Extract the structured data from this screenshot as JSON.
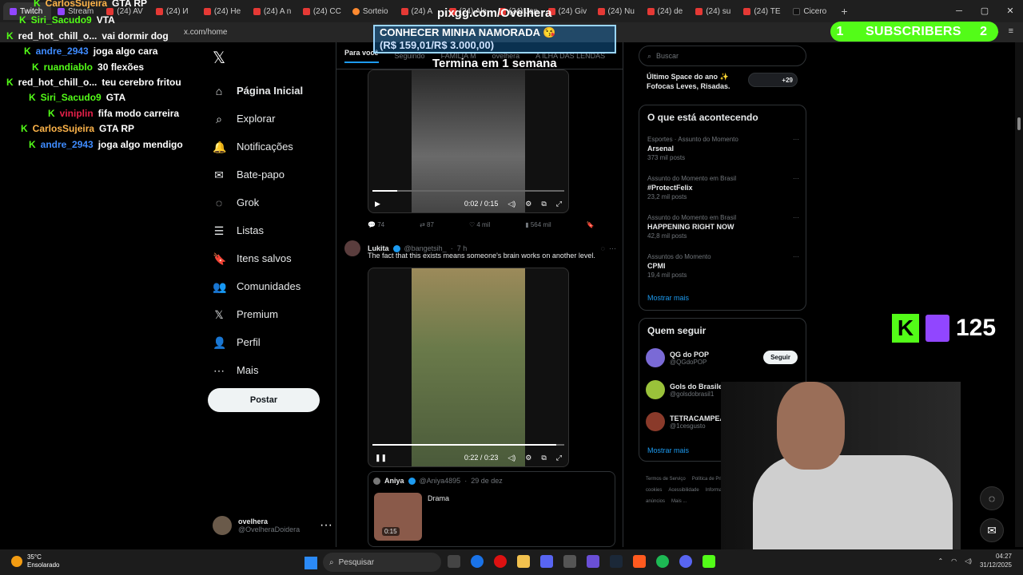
{
  "browser": {
    "tabs": [
      {
        "label": "Twitch",
        "icon": "twitch-icon"
      },
      {
        "label": "Stream",
        "icon": "twitch-icon"
      },
      {
        "label": "(24) AV",
        "icon": "youtube-icon"
      },
      {
        "label": "(24) И",
        "icon": "youtube-icon"
      },
      {
        "label": "(24) He",
        "icon": "youtube-icon"
      },
      {
        "label": "(24) A n",
        "icon": "youtube-icon"
      },
      {
        "label": "(24) CC",
        "icon": "youtube-icon"
      },
      {
        "label": "Sorteio",
        "icon": "sorteio-icon"
      },
      {
        "label": "(24) A",
        "icon": "youtube-icon"
      },
      {
        "label": "(24) Ale",
        "icon": "youtube-icon"
      },
      {
        "label": "(24) Jan",
        "icon": "youtube-icon"
      },
      {
        "label": "(24) Giv",
        "icon": "youtube-icon"
      },
      {
        "label": "(24) Nu",
        "icon": "youtube-icon"
      },
      {
        "label": "(24) de",
        "icon": "youtube-icon"
      },
      {
        "label": "(24) su",
        "icon": "youtube-icon"
      },
      {
        "label": "(24) TE",
        "icon": "youtube-icon"
      },
      {
        "label": "Cicero",
        "icon": "tiktok-icon"
      }
    ],
    "new_tab": "+",
    "address": "x.com/home"
  },
  "overlay": {
    "chat": [
      {
        "user": "CarlosSujeira",
        "msg": "GTA RP",
        "color": "#ffb54a"
      },
      {
        "user": "Siri_Sacudo9",
        "msg": "VTA",
        "color": "#53fc18"
      },
      {
        "user": "red_hot_chill_o...",
        "msg": "vai dormir dog",
        "color": "#ffffff"
      },
      {
        "user": "andre_2943",
        "msg": "joga algo cara",
        "color": "#3f8cff"
      },
      {
        "user": "ruandiablo",
        "msg": "30 flexões",
        "color": "#53fc18"
      },
      {
        "user": "red_hot_chill_o...",
        "msg": "teu cerebro fritou",
        "color": "#ffffff"
      },
      {
        "user": "Siri_Sacudo9",
        "msg": "GTA",
        "color": "#53fc18"
      },
      {
        "user": "viniplin",
        "msg": "fifa modo carreira",
        "color": "#e6204a"
      },
      {
        "user": "CarlosSujeira",
        "msg": "GTA RP",
        "color": "#ffb54a"
      },
      {
        "user": "andre_2943",
        "msg": "joga algo mendigo",
        "color": "#3f8cff"
      }
    ],
    "site_url": "pixgg.com/Ovelhera",
    "banner_line1": "CONHECER MINHA NAMORADA 😘",
    "banner_line2": "(R$ 159,01/R$ 3.000,00)",
    "goal_progress": 0.053,
    "banner_subtitle": "Termina em 1 semana",
    "subs_count": "1",
    "subs_label": "SUBSCRIBERS",
    "subs_extra": "2",
    "viewer_count": "125"
  },
  "x": {
    "nav": [
      {
        "label": "Página Inicial",
        "icon": "home-icon",
        "active": true
      },
      {
        "label": "Explorar",
        "icon": "search-icon"
      },
      {
        "label": "Notificações",
        "icon": "bell-icon"
      },
      {
        "label": "Bate-papo",
        "icon": "mail-icon"
      },
      {
        "label": "Grok",
        "icon": "grok-icon"
      },
      {
        "label": "Listas",
        "icon": "list-icon"
      },
      {
        "label": "Itens salvos",
        "icon": "bookmark-icon"
      },
      {
        "label": "Comunidades",
        "icon": "people-icon"
      },
      {
        "label": "Premium",
        "icon": "x-logo-icon"
      },
      {
        "label": "Perfil",
        "icon": "user-icon"
      },
      {
        "label": "Mais",
        "icon": "more-icon"
      }
    ],
    "post_button": "Postar",
    "profile_name": "ovelhera",
    "profile_handle": "@OvelheraDoidera",
    "feed_tabs": [
      "Para você",
      "Seguindo",
      "FAMILIA M",
      "ovelhera",
      "A ILHA DAS LENDAS"
    ],
    "video1": {
      "time": "0:02 / 0:15",
      "progress": 0.13
    },
    "stats1": {
      "replies": "74",
      "reposts": "87",
      "likes": "4 mil",
      "views": "564 mil"
    },
    "tweet2": {
      "name": "Lukita",
      "handle": "@bangetsih_",
      "time": "7 h",
      "text": "The fact that this exists means someone's brain works on another level.",
      "video_time": "0:22 / 0:23",
      "progress": 0.96
    },
    "quote": {
      "name": "Aniya",
      "handle": "@Aniya4895",
      "date": "29 de dez",
      "text": "Drama",
      "duration": "0:15"
    },
    "search_placeholder": "Buscar",
    "space_title": "Último Space do ano ✨",
    "space_sub": "Fofocas Leves, Risadas.",
    "space_count": "+29",
    "trends_title": "O que está acontecendo",
    "trends": [
      {
        "context": "Esportes · Assunto do Momento",
        "topic": "Arsenal",
        "posts": "373 mil posts"
      },
      {
        "context": "Assunto do Momento em Brasil",
        "topic": "#ProtectFelix",
        "posts": "23,2 mil posts"
      },
      {
        "context": "Assunto do Momento em Brasil",
        "topic": "HAPPENING RIGHT NOW",
        "posts": "42,8 mil posts"
      },
      {
        "context": "Assuntos do Momento",
        "topic": "CPMI",
        "posts": "19,4 mil posts"
      }
    ],
    "show_more": "Mostrar mais",
    "who_title": "Quem seguir",
    "who": [
      {
        "name": "QG do POP",
        "handle": "@QGdoPOP",
        "color": "#7a6ad6"
      },
      {
        "name": "Gols do Brasileirão ...",
        "handle": "@golsdobrasil1",
        "color": "#9ac23a"
      },
      {
        "name": "TETRACAMPEÃO DA C...",
        "handle": "@1cesgusto",
        "color": "#8a3a2a"
      }
    ],
    "follow_label": "Seguir",
    "footer": [
      "Termos de Serviço",
      "Política de Privacidade",
      "Política de cookies",
      "Acessibilidade",
      "Informações de anúncios",
      "Mais ..."
    ]
  },
  "taskbar": {
    "temp": "35°C",
    "weather": "Ensolarado",
    "search": "Pesquisar",
    "time": "04:27",
    "date": "31/12/2025"
  }
}
